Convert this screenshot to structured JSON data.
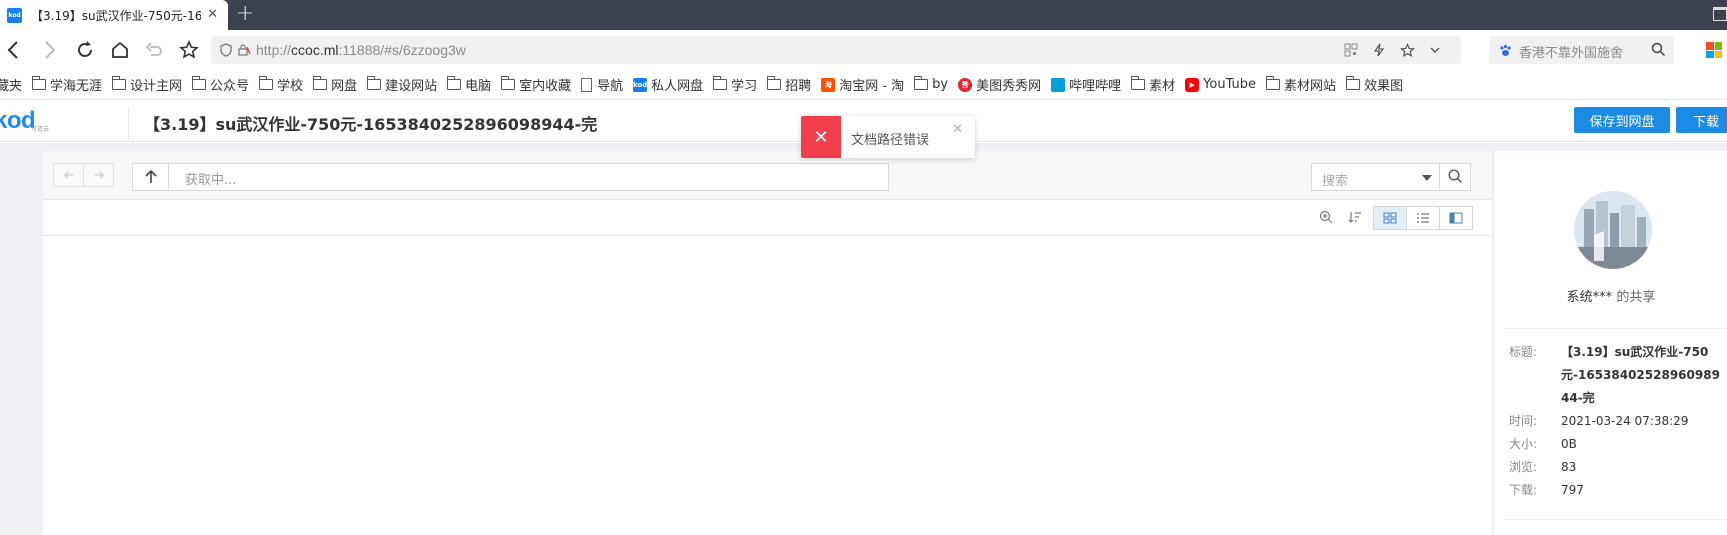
{
  "browser": {
    "tab_title": "【3.19】su武汉作业-750元-16",
    "tab_favicon": "kod",
    "url_scheme": "http://",
    "url_host": "ccoc.ml",
    "url_rest": ":11888/#s/6zzoog3w",
    "search_placeholder": "香港不靠外国施舍",
    "bookmarks": [
      {
        "label": "藏夹",
        "icon": "none"
      },
      {
        "label": "学海无涯",
        "icon": "folder"
      },
      {
        "label": "设计主网",
        "icon": "folder"
      },
      {
        "label": "公众号",
        "icon": "folder"
      },
      {
        "label": "学校",
        "icon": "folder"
      },
      {
        "label": "网盘",
        "icon": "folder"
      },
      {
        "label": "建设网站",
        "icon": "folder"
      },
      {
        "label": "电脑",
        "icon": "folder"
      },
      {
        "label": "室内收藏",
        "icon": "folder"
      },
      {
        "label": "导航",
        "icon": "page"
      },
      {
        "label": "私人网盘",
        "icon": "kod"
      },
      {
        "label": "学习",
        "icon": "folder"
      },
      {
        "label": "招聘",
        "icon": "folder"
      },
      {
        "label": "淘宝网 - 淘",
        "icon": "taobao"
      },
      {
        "label": "by",
        "icon": "folder"
      },
      {
        "label": "美图秀秀网",
        "icon": "meitu"
      },
      {
        "label": "哔哩哔哩",
        "icon": "bilibili"
      },
      {
        "label": "素材",
        "icon": "folder"
      },
      {
        "label": "YouTube",
        "icon": "youtube"
      },
      {
        "label": "素材网站",
        "icon": "folder"
      },
      {
        "label": "效果图",
        "icon": "folder"
      }
    ]
  },
  "app": {
    "logo": "kod",
    "logo_sub": "可道云",
    "share_title": "【3.19】su武汉作业-750元-1653840252896098944-完",
    "save_button": "保存到网盘",
    "download_button": "下载",
    "toast_message": "文档路径错误",
    "path_placeholder": "获取中...",
    "search_placeholder": "搜索"
  },
  "sidebar": {
    "owner_name": "系统***",
    "owner_suffix": " 的共享",
    "meta": [
      {
        "key": "标题:",
        "value": "【3.19】su武汉作业-750元-1653840252896098944-完"
      },
      {
        "key": "时间:",
        "value": "2021-03-24 07:38:29"
      },
      {
        "key": "大小:",
        "value": "0B"
      },
      {
        "key": "浏览:",
        "value": "83"
      },
      {
        "key": "下载:",
        "value": "797"
      }
    ]
  },
  "colors": {
    "accent": "#1b8be3",
    "error": "#f03e4c",
    "tabstrip": "#3c4150"
  }
}
